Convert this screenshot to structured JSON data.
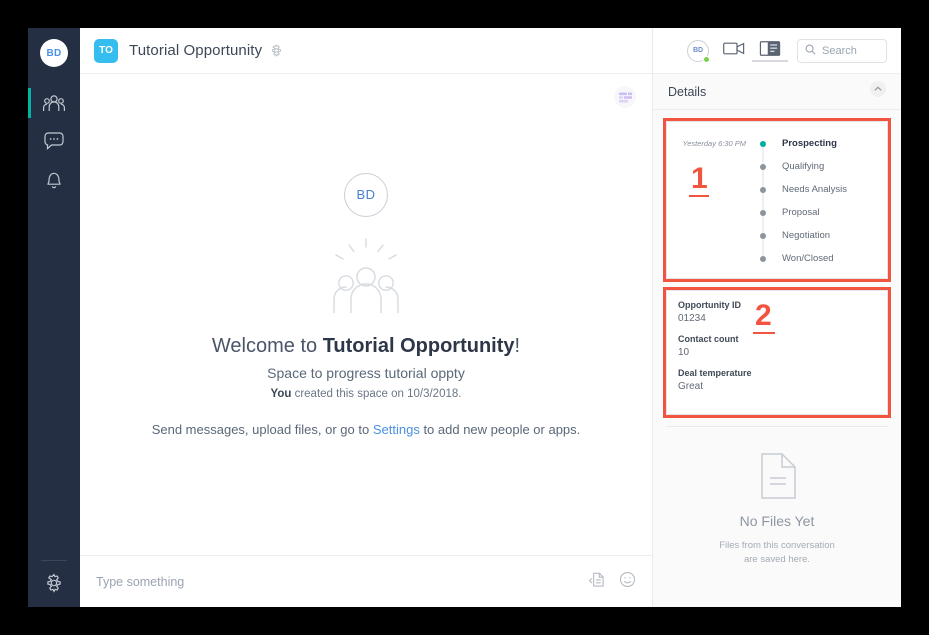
{
  "rail": {
    "avatar": "BD",
    "items": [
      {
        "name": "teams-icon",
        "label": "Teams",
        "active": true
      },
      {
        "name": "messages-icon",
        "label": "Messages",
        "active": false
      },
      {
        "name": "notifications-icon",
        "label": "Notifications",
        "active": false
      }
    ],
    "settings_label": "Settings"
  },
  "space": {
    "badge": "TO",
    "title": "Tutorial Opportunity",
    "gear_icon": "gear-icon"
  },
  "welcome": {
    "avatar": "BD",
    "heading_prefix": "Welcome to ",
    "heading_name": "Tutorial Opportunity",
    "heading_suffix": "!",
    "subtitle": "Space to progress tutorial oppty",
    "meta_bold": "You",
    "meta_rest": " created this space on 10/3/2018.",
    "cta_before": "Send messages, upload files, or go to ",
    "cta_link": "Settings",
    "cta_after": " to add new people or apps."
  },
  "composer": {
    "placeholder": "Type something",
    "value": "",
    "attach_icon": "attach-file-icon",
    "emoji_icon": "emoji-icon"
  },
  "right_header": {
    "avatar": "BD",
    "meet_icon": "video-camera-icon",
    "panel_icon": "split-view-icon",
    "search_placeholder": "Search",
    "search_value": ""
  },
  "details": {
    "title": "Details",
    "collapse_icon": "chevron-up-icon"
  },
  "stages": {
    "annotation": "1",
    "items": [
      {
        "time": "Yesterday 6:30 PM",
        "label": "Prospecting",
        "current": true
      },
      {
        "time": "",
        "label": "Qualifying",
        "current": false
      },
      {
        "time": "",
        "label": "Needs Analysis",
        "current": false
      },
      {
        "time": "",
        "label": "Proposal",
        "current": false
      },
      {
        "time": "",
        "label": "Negotiation",
        "current": false
      },
      {
        "time": "",
        "label": "Won/Closed",
        "current": false
      }
    ]
  },
  "info": {
    "annotation": "2",
    "fields": [
      {
        "label": "Opportunity ID",
        "value": "01234"
      },
      {
        "label": "Contact count",
        "value": "10"
      },
      {
        "label": "Deal temperature",
        "value": "Great"
      }
    ]
  },
  "files": {
    "title": "No Files Yet",
    "sub_line1": "Files from this conversation",
    "sub_line2": "are saved here.",
    "icon": "document-icon"
  },
  "colors": {
    "rail_bg": "#242f43",
    "accent_teal": "#00ae9e",
    "badge_blue": "#36bdf0",
    "link_blue": "#4a90e2",
    "annotation_red": "#f1543f"
  }
}
